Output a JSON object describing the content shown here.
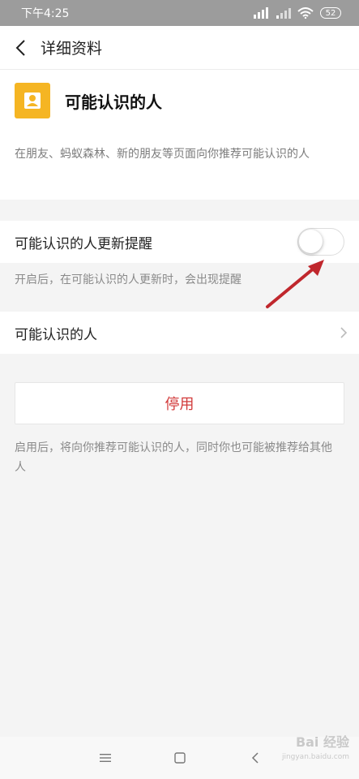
{
  "status_bar": {
    "time": "下午4:25",
    "battery": "52"
  },
  "nav": {
    "title": "详细资料"
  },
  "profile": {
    "name": "可能认识的人",
    "description": "在朋友、蚂蚁森林、新的朋友等页面向你推荐可能认识的人",
    "icon_color": "#f5b523"
  },
  "toggle_setting": {
    "label": "可能认识的人更新提醒",
    "state": false,
    "hint": "开启后，在可能认识的人更新时，会出现提醒"
  },
  "link_row": {
    "label": "可能认识的人"
  },
  "disable": {
    "label": "停用",
    "hint": "启用后，将向你推荐可能认识的人，同时你也可能被推荐给其他人",
    "color": "#d23a3a"
  },
  "annotation": {
    "arrow_color": "#c0272d"
  },
  "watermark": {
    "brand": "Bai 经验",
    "url": "jingyan.baidu.com"
  }
}
